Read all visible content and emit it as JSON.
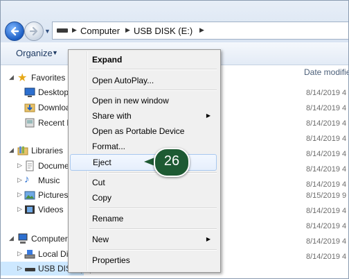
{
  "address": {
    "crumbs": [
      "Computer",
      "USB DISK (E:)"
    ]
  },
  "toolbar": {
    "organize_label": "Organize"
  },
  "nav": {
    "items": [
      {
        "label": "Favorites",
        "icon": "star-icon"
      },
      {
        "label": "Desktop",
        "icon": "desktop-icon"
      },
      {
        "label": "Downloads",
        "icon": "downloads-folder-icon"
      },
      {
        "label": "Recent Places",
        "icon": "recent-places-icon"
      },
      {
        "label": "Libraries",
        "icon": "libraries-icon"
      },
      {
        "label": "Documents",
        "icon": "documents-icon"
      },
      {
        "label": "Music",
        "icon": "music-icon"
      },
      {
        "label": "Pictures",
        "icon": "pictures-icon"
      },
      {
        "label": "Videos",
        "icon": "videos-icon"
      },
      {
        "label": "Computer",
        "icon": "computer-icon"
      },
      {
        "label": "Local Disk (C:)",
        "icon": "local-disk-icon"
      },
      {
        "label": "USB DISK (E:)",
        "icon": "usb-drive-icon"
      }
    ]
  },
  "files": {
    "date_header": "Date modified",
    "dates": [
      "8/14/2019 4",
      "8/14/2019 4",
      "8/14/2019 4",
      "8/14/2019 4",
      "8/14/2019 4",
      "8/14/2019 4",
      "8/14/2019 4",
      "8/15/2019 9",
      "8/14/2019 4",
      "8/14/2019 4",
      "8/14/2019 4",
      "8/14/2019 4"
    ]
  },
  "context_menu": {
    "items": [
      {
        "label": "Expand",
        "bold": true
      },
      {
        "label": "Open AutoPlay..."
      },
      {
        "label": "Open in new window"
      },
      {
        "label": "Share with",
        "submenu": true
      },
      {
        "label": "Open as Portable Device"
      },
      {
        "label": "Format..."
      },
      {
        "label": "Eject",
        "highlighted": true
      },
      {
        "label": "Cut"
      },
      {
        "label": "Copy"
      },
      {
        "label": "Rename"
      },
      {
        "label": "New",
        "submenu": true
      },
      {
        "label": "Properties"
      }
    ]
  },
  "callout": {
    "step": "26",
    "color": "#1e5a33"
  }
}
